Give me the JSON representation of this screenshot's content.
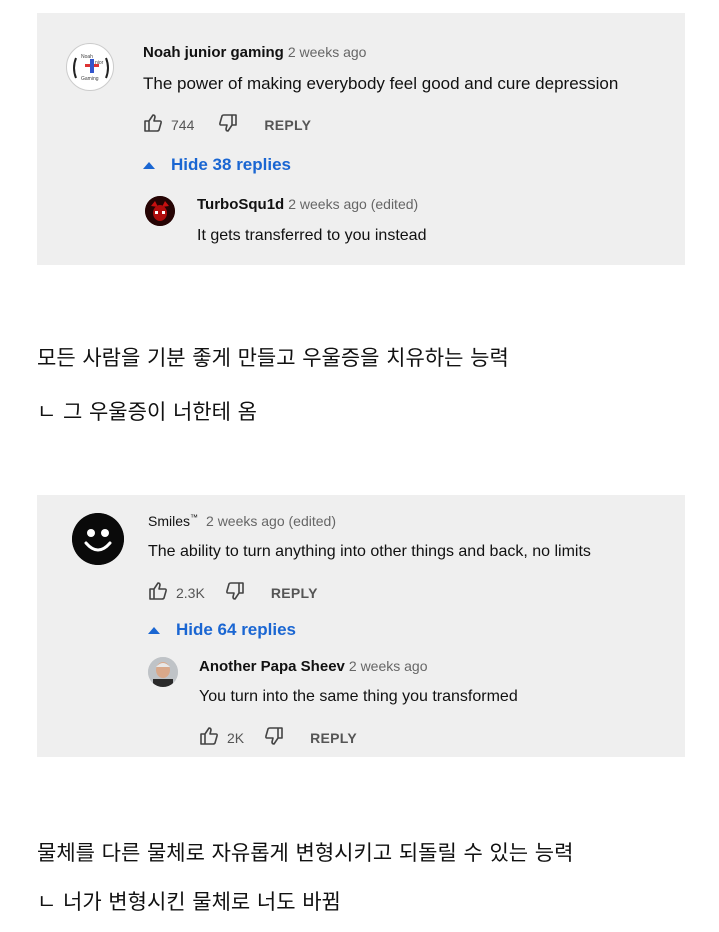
{
  "comments": [
    {
      "author": "Noah junior gaming",
      "time": "2 weeks ago",
      "text": "The power of making everybody feel good and cure depression",
      "likes": "744",
      "reply_label": "REPLY",
      "replies_toggle": "Hide 38 replies",
      "avatar_text": "Noah junior Gaming",
      "reply": {
        "author": "TurboSqu1d",
        "time": "2 weeks ago (edited)",
        "text": "It gets transferred to you instead"
      }
    },
    {
      "author": "Smiles",
      "author_mark": "™",
      "time": "2 weeks ago (edited)",
      "text": "The ability to turn anything into other things and back, no limits",
      "likes": "2.3K",
      "reply_label": "REPLY",
      "replies_toggle": "Hide 64 replies",
      "reply": {
        "author": "Another Papa Sheev",
        "time": "2 weeks ago",
        "text": "You turn into the same thing you transformed",
        "likes": "2K",
        "reply_label": "REPLY"
      }
    }
  ],
  "captions": [
    {
      "line1": "모든 사람을 기분 좋게 만들고 우울증을 치유하는 능력",
      "line2": "ㄴ 그 우울증이 너한테 옴"
    },
    {
      "line1": "물체를 다른 물체로 자유롭게 변형시키고 되돌릴 수 있는 능력",
      "line2": "ㄴ 너가 변형시킨 물체로 너도 바뀜"
    }
  ],
  "colors": {
    "link_blue": "#1a66d2",
    "card_bg": "#efefef"
  }
}
